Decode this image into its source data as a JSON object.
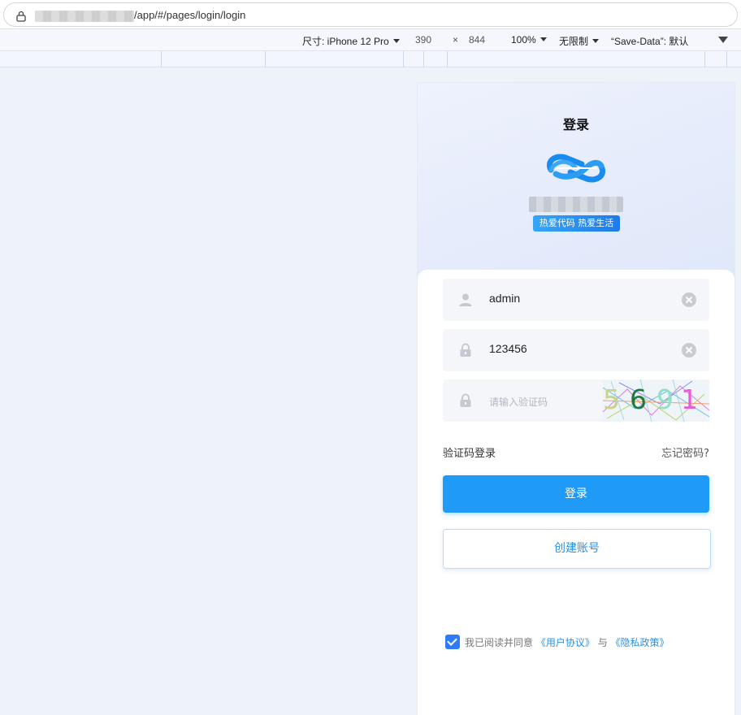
{
  "browser": {
    "url_suffix": "/app/#/pages/login/login"
  },
  "device_toolbar": {
    "size_label": "尺寸: iPhone 12 Pro",
    "width": "390",
    "times": "×",
    "height": "844",
    "zoom": "100%",
    "throttle": "无限制",
    "save_data": "“Save-Data”: 默认"
  },
  "app": {
    "title": "登录",
    "slogan": "热爱代码 热爱生活",
    "username_value": "admin",
    "password_value": "123456",
    "captcha_placeholder": "请输入验证码",
    "captcha_digits": [
      {
        "text": "5",
        "color": "#c9d48a"
      },
      {
        "text": "6",
        "color": "#1e7a3a"
      },
      {
        "text": "9",
        "color": "#8fe0c6"
      },
      {
        "text": "1",
        "color": "#e85ad6"
      }
    ],
    "sms_login_link": "验证码登录",
    "forgot_link": "忘记密码?",
    "login_button": "登录",
    "create_button": "创建账号",
    "agree_prefix": "我已阅读并同意",
    "user_agreement": "《用户协议》",
    "agree_and": "与",
    "privacy_policy": "《隐私政策》",
    "agree_checked": true,
    "colors": {
      "primary": "#1f9bf7",
      "link": "#2d8fe0",
      "checkbox": "#2f7cf6"
    }
  }
}
